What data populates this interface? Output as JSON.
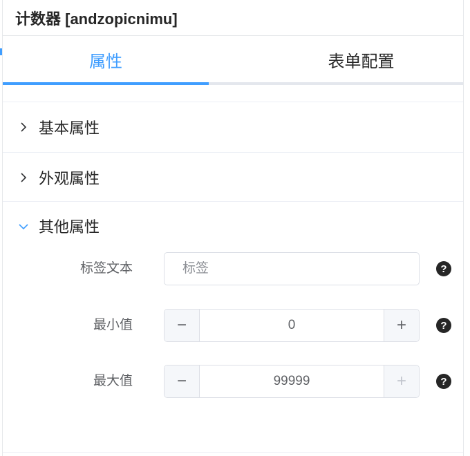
{
  "header": {
    "title": "计数器 [andzopicnimu]"
  },
  "tabs": [
    {
      "label": "属性",
      "active": true
    },
    {
      "label": "表单配置",
      "active": false
    }
  ],
  "sections": [
    {
      "title": "基本属性",
      "expanded": false
    },
    {
      "title": "外观属性",
      "expanded": false
    },
    {
      "title": "其他属性",
      "expanded": true
    }
  ],
  "fields": {
    "label_text": {
      "label": "标签文本",
      "placeholder": "标签",
      "value": ""
    },
    "min_value": {
      "label": "最小值",
      "value": "0"
    },
    "max_value": {
      "label": "最大值",
      "value": "99999"
    }
  },
  "icons": {
    "minus": "−",
    "plus": "+",
    "help": "?"
  },
  "colors": {
    "accent": "#409eff",
    "text": "#262626",
    "label": "#606266",
    "border": "#dcdfe6"
  }
}
